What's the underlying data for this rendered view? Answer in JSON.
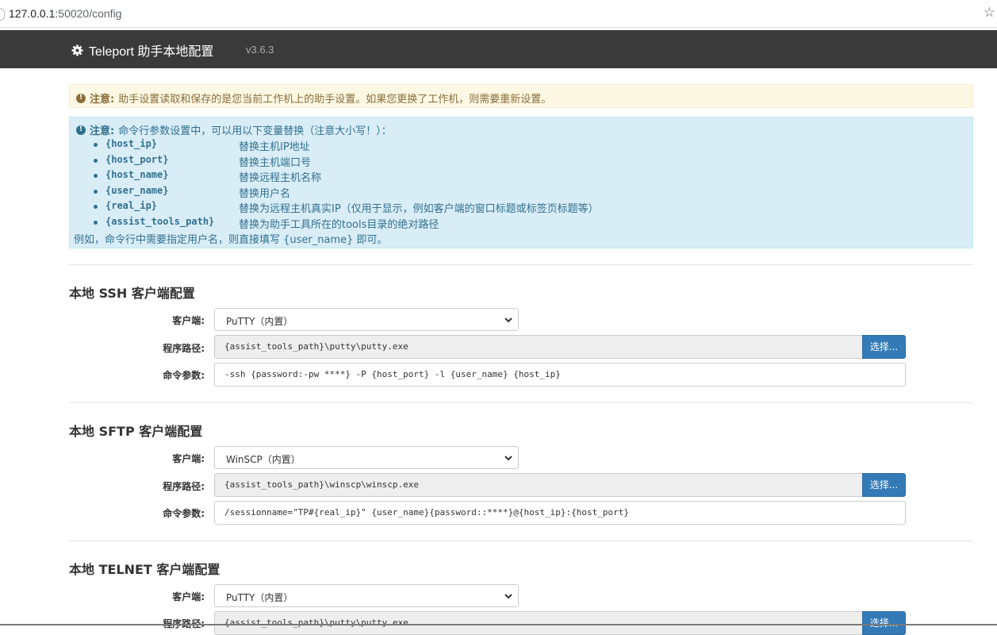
{
  "browser": {
    "url_host": "127.0.0.1",
    "url_rest": ":50020/config"
  },
  "navbar": {
    "title": "Teleport 助手本地配置",
    "version": "v3.6.3"
  },
  "warning": {
    "label": "注意:",
    "text": "助手设置读取和保存的是您当前工作机上的助手设置。如果您更换了工作机，则需要重新设置。"
  },
  "info": {
    "label": "注意:",
    "text": "命令行参数设置中，可以用以下变量替换（注意大小写！）：",
    "vars": [
      {
        "name": "{host_ip}",
        "desc": "替换主机IP地址"
      },
      {
        "name": "{host_port}",
        "desc": "替换主机端口号"
      },
      {
        "name": "{host_name}",
        "desc": "替换远程主机名称"
      },
      {
        "name": "{user_name}",
        "desc": "替换用户名"
      },
      {
        "name": "{real_ip}",
        "desc": "替换为远程主机真实IP（仅用于显示，例如客户端的窗口标题或标签页标题等）"
      },
      {
        "name": "{assist_tools_path}",
        "desc": "替换为助手工具所在的tools目录的绝对路径"
      }
    ],
    "footer": "例如，命令行中需要指定用户名，则直接填写 {user_name} 即可。"
  },
  "sections": [
    {
      "title": "本地 SSH 客户端配置",
      "client_label": "客户端:",
      "client_value": "PuTTY（内置）",
      "path_label": "程序路径:",
      "path_value": "{assist_tools_path}\\putty\\putty.exe",
      "args_label": "命令参数:",
      "args_value": "-ssh {password:-pw ****} -P {host_port} -l {user_name} {host_ip}",
      "browse_label": "选择..."
    },
    {
      "title": "本地 SFTP 客户端配置",
      "client_label": "客户端:",
      "client_value": "WinSCP（内置）",
      "path_label": "程序路径:",
      "path_value": "{assist_tools_path}\\winscp\\winscp.exe",
      "args_label": "命令参数:",
      "args_value": "/sessionname=\"TP#{real_ip}\" {user_name}{password::****}@{host_ip}:{host_port}",
      "browse_label": "选择..."
    },
    {
      "title": "本地 TELNET 客户端配置",
      "client_label": "客户端:",
      "client_value": "PuTTY（内置）",
      "path_label": "程序路径:",
      "path_value": "{assist_tools_path}\\putty\\putty.exe",
      "browse_label": "选择..."
    }
  ]
}
